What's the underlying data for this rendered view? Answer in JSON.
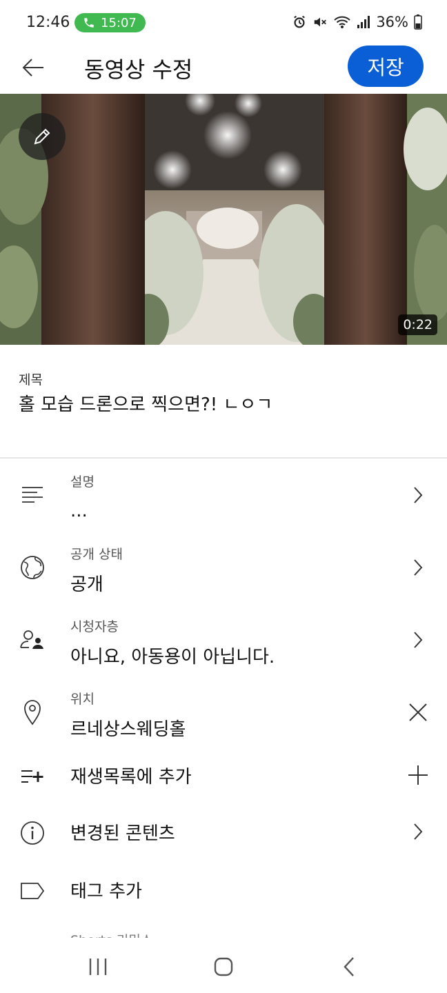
{
  "status_bar": {
    "time": "12:46",
    "call_timer": "15:07",
    "battery": "36%",
    "icons": [
      "alarm-icon",
      "mute-icon",
      "wifi-icon",
      "signal-icon",
      "battery-icon"
    ]
  },
  "header": {
    "title": "동영상 수정",
    "save_label": "저장"
  },
  "video": {
    "duration": "0:22"
  },
  "title_field": {
    "label": "제목",
    "value": "홀 모습 드론으로 찍으면?! ㄴㅇㄱ"
  },
  "rows": [
    {
      "icon": "description-icon",
      "label": "설명",
      "value": "...",
      "trailing": "chevron-right-icon"
    },
    {
      "icon": "globe-icon",
      "label": "공개 상태",
      "value": "공개",
      "trailing": "chevron-right-icon"
    },
    {
      "icon": "audience-icon",
      "label": "시청자층",
      "value": "아니요, 아동용이 아닙니다.",
      "trailing": "chevron-right-icon"
    },
    {
      "icon": "location-pin-icon",
      "label": "위치",
      "value": "르네상스웨딩홀",
      "trailing": "close-icon"
    },
    {
      "icon": "playlist-add-icon",
      "label": "",
      "value": "재생목록에 추가",
      "trailing": "plus-icon"
    },
    {
      "icon": "info-icon",
      "label": "",
      "value": "변경된 콘텐츠",
      "trailing": "chevron-right-icon"
    },
    {
      "icon": "tag-icon",
      "label": "",
      "value": "태그 추가",
      "trailing": ""
    }
  ],
  "partial_row_label": "Shorts 리믹스",
  "colors": {
    "accent": "#0a5fd6",
    "call_green": "#3fb950"
  }
}
